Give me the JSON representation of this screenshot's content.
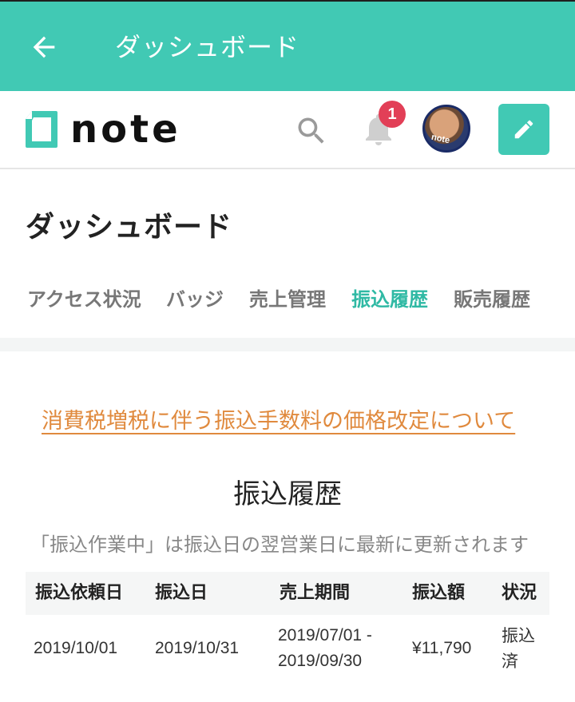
{
  "app_bar": {
    "back_icon": "arrow-left-icon",
    "title": "ダッシュボード",
    "background": "#41c9b4"
  },
  "header": {
    "logo_text": "note",
    "search_icon": "search-icon",
    "bell_icon": "bell-icon",
    "notification_count": "1",
    "badge_color": "#e23f57",
    "avatar_tag": "note",
    "compose_icon": "pencil-icon"
  },
  "page": {
    "title": "ダッシュボード",
    "tabs": [
      {
        "label": "アクセス状況",
        "active": false
      },
      {
        "label": "バッジ",
        "active": false
      },
      {
        "label": "売上管理",
        "active": false
      },
      {
        "label": "振込履歴",
        "active": true
      },
      {
        "label": "販売履歴",
        "active": false
      }
    ],
    "accent": "#2fb9a4"
  },
  "notice": {
    "link_text": "消費税増税に伴う振込手数料の価格改定について",
    "color": "#e08a3e"
  },
  "history": {
    "title": "振込履歴",
    "note": "「振込作業中」は振込日の翌営業日に最新に更新されます",
    "columns": [
      "振込依頼日",
      "振込日",
      "売上期間",
      "振込額",
      "状況"
    ],
    "rows": [
      {
        "request_date": "2019/10/01",
        "transfer_date": "2019/10/31",
        "period_line1": "2019/07/01 -",
        "period_line2": "2019/09/30",
        "amount": "¥11,790",
        "status_line1": "振込",
        "status_line2": "済"
      }
    ]
  }
}
